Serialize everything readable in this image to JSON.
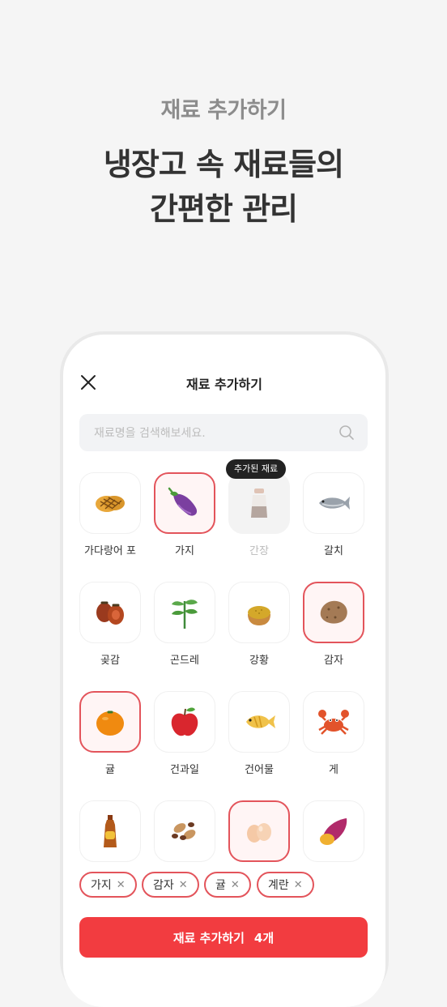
{
  "promo": {
    "subtitle": "재료 추가하기",
    "title_line1": "냉장고 속 재료들의",
    "title_line2": "간편한 관리"
  },
  "screen": {
    "title": "재료 추가하기",
    "search_placeholder": "재료명을 검색해보세요."
  },
  "items": [
    {
      "label": "가다랑어 포",
      "icon": "bonito-flakes-icon",
      "state": "normal"
    },
    {
      "label": "가지",
      "icon": "eggplant-icon",
      "state": "selected"
    },
    {
      "label": "간장",
      "icon": "soy-sauce-icon",
      "state": "added",
      "badge": "추가된 재료"
    },
    {
      "label": "갈치",
      "icon": "fish-icon",
      "state": "normal"
    },
    {
      "label": "곶감",
      "icon": "dried-persimmon-icon",
      "state": "normal"
    },
    {
      "label": "곤드레",
      "icon": "gondre-herb-icon",
      "state": "normal"
    },
    {
      "label": "강황",
      "icon": "turmeric-icon",
      "state": "normal"
    },
    {
      "label": "감자",
      "icon": "potato-icon",
      "state": "selected"
    },
    {
      "label": "귤",
      "icon": "tangerine-icon",
      "state": "selected"
    },
    {
      "label": "건과일",
      "icon": "apple-icon",
      "state": "normal"
    },
    {
      "label": "건어물",
      "icon": "dried-fish-icon",
      "state": "normal"
    },
    {
      "label": "게",
      "icon": "crab-icon",
      "state": "normal"
    },
    {
      "label": "",
      "icon": "sesame-oil-bottle-icon",
      "state": "normal"
    },
    {
      "label": "",
      "icon": "peanuts-icon",
      "state": "normal"
    },
    {
      "label": "",
      "icon": "eggs-icon",
      "state": "selected"
    },
    {
      "label": "",
      "icon": "sweet-potato-icon",
      "state": "normal"
    }
  ],
  "chips": [
    {
      "label": "가지"
    },
    {
      "label": "감자"
    },
    {
      "label": "귤"
    },
    {
      "label": "계란"
    }
  ],
  "chip_remove_glyph": "✕",
  "cta": {
    "label": "재료 추가하기",
    "count": "4개"
  },
  "colors": {
    "accent": "#f23c40",
    "selected_border": "#e3545b"
  }
}
